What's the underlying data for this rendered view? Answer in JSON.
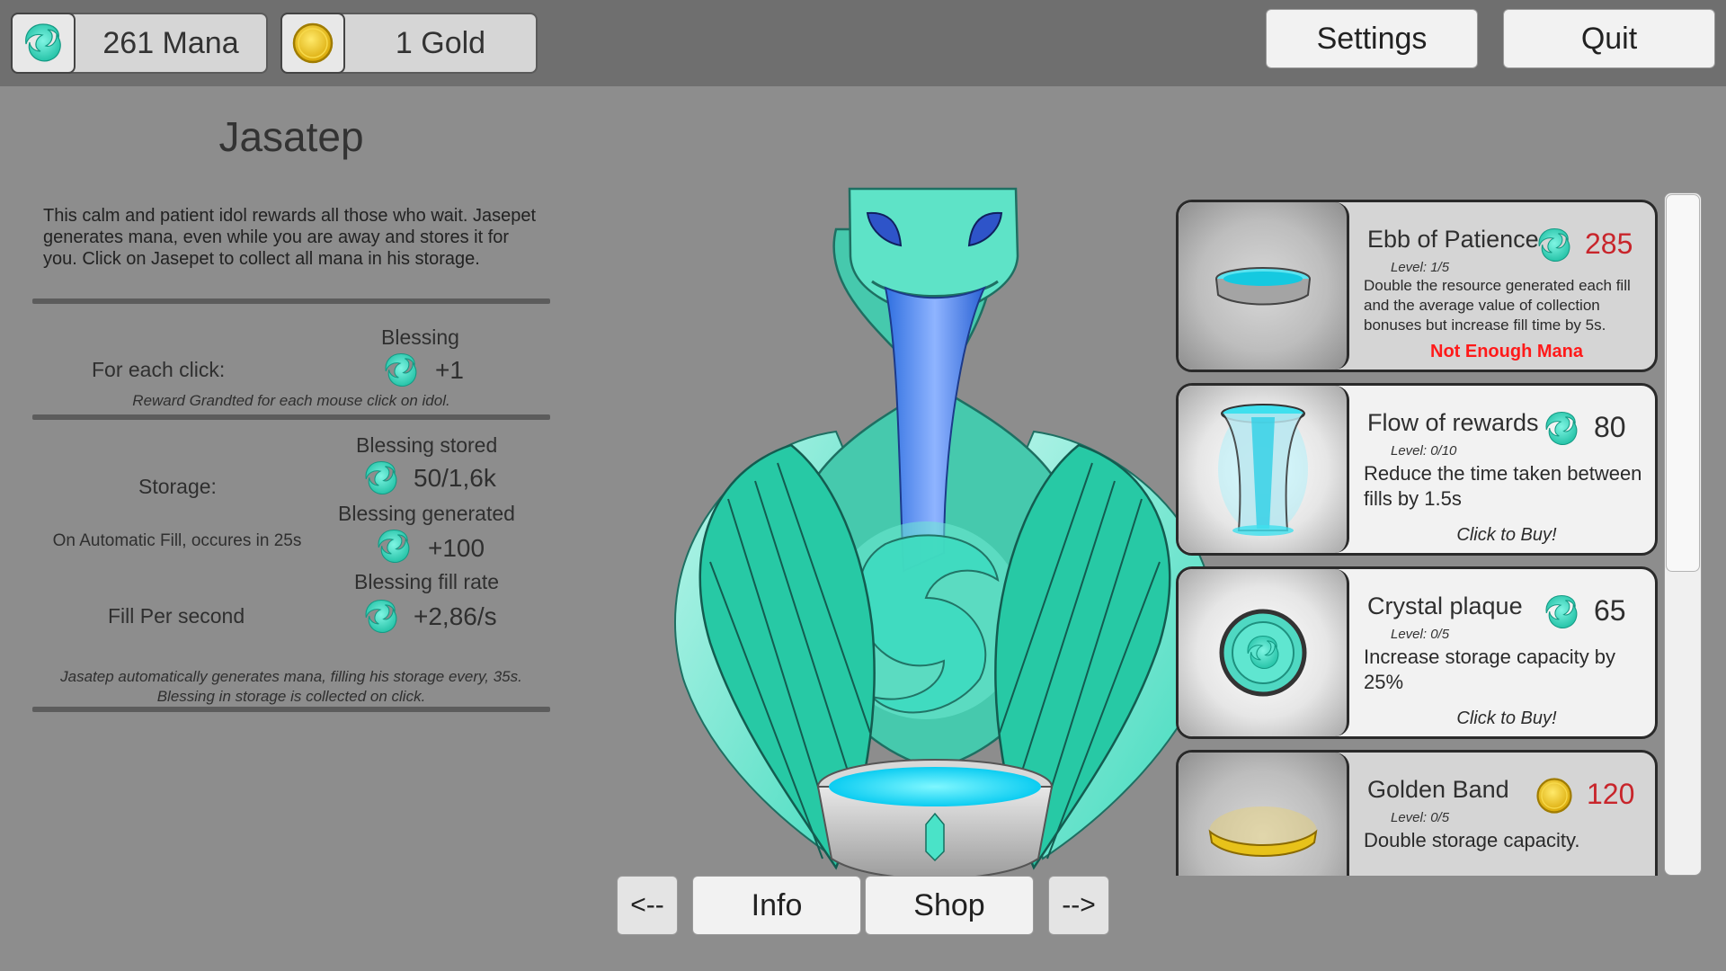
{
  "resources": {
    "mana": {
      "label": "261 Mana",
      "icon": "mana-swirl-icon"
    },
    "gold": {
      "label": "1 Gold",
      "icon": "gold-coin-icon"
    }
  },
  "top_buttons": {
    "settings": "Settings",
    "quit": "Quit"
  },
  "idol_info": {
    "title": "Jasatep",
    "description": "This calm and patient idol rewards all those who wait. Jasepet generates mana, even while you are away and stores it for you. Click on Jasepet to collect all mana in his storage.",
    "click_section": {
      "header": "Blessing",
      "label": "For each click:",
      "value": "+1",
      "note": "Reward Grandted for each mouse click on idol."
    },
    "storage_section": {
      "stored_header": "Blessing stored",
      "storage_label": "Storage:",
      "storage_value": "50/1,6k",
      "generated_header": "Blessing generated",
      "auto_fill_label": "On Automatic Fill, occures in 25s",
      "generated_value": "+100",
      "fill_rate_header": "Blessing fill rate",
      "fill_label": "Fill Per second",
      "fill_value": "+2,86/s",
      "note": "Jasatep automatically generates mana, filling his storage every, 35s. Blessing in storage is collected on click."
    }
  },
  "nav": {
    "prev": "<--",
    "info": "Info",
    "shop": "Shop",
    "next": "-->"
  },
  "shop_items": [
    {
      "name": "Ebb of Patience",
      "currency": "mana",
      "price": "285",
      "level": "Level: 1/5",
      "description": "Double the resource generated each fill and the average value of collection bonuses but increase fill time by 5s.",
      "status": "Not Enough Mana",
      "affordable": false
    },
    {
      "name": "Flow of rewards",
      "currency": "mana",
      "price": "80",
      "level": "Level: 0/10",
      "description": "Reduce the time taken between fills by 1.5s",
      "status": "Click to Buy!",
      "affordable": true
    },
    {
      "name": "Crystal plaque",
      "currency": "mana",
      "price": "65",
      "level": "Level: 0/5",
      "description": "Increase storage capacity by 25%",
      "status": "Click to Buy!",
      "affordable": true
    },
    {
      "name": "Golden Band",
      "currency": "gold",
      "price": "120",
      "level": "Level: 0/5",
      "description": "Double storage capacity.",
      "status": "",
      "affordable": false
    }
  ],
  "colors": {
    "mana": "#3de0c5",
    "gold": "#e7c21a",
    "price_unaffordable": "#c8252b",
    "status_warning": "#ff1a1a",
    "topbar": "#6f6f6f",
    "background": "#8d8d8d"
  }
}
